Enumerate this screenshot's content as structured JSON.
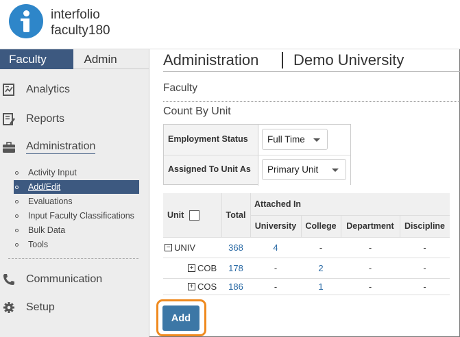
{
  "brand": {
    "line1": "interfolio",
    "line2": "faculty180"
  },
  "sidebar": {
    "tabs": [
      {
        "label": "Faculty"
      },
      {
        "label": "Admin"
      }
    ],
    "nav": {
      "analytics": "Analytics",
      "reports": "Reports",
      "administration": "Administration",
      "communication": "Communication",
      "setup": "Setup"
    },
    "subitems": [
      {
        "label": "Activity Input"
      },
      {
        "label": "Add/Edit"
      },
      {
        "label": "Evaluations"
      },
      {
        "label": "Input Faculty Classifications"
      },
      {
        "label": "Bulk Data"
      },
      {
        "label": "Tools"
      }
    ]
  },
  "main": {
    "title": "Administration",
    "university": "Demo University",
    "section": "Faculty",
    "subsection": "Count By Unit",
    "filters": {
      "employment_status": {
        "label": "Employment Status",
        "value": "Full Time"
      },
      "assigned_to_unit_as": {
        "label": "Assigned To Unit As",
        "value": "Primary Unit"
      }
    },
    "table": {
      "headers": {
        "unit": "Unit",
        "total": "Total",
        "attached_in": "Attached In",
        "university": "University",
        "college": "College",
        "department": "Department",
        "discipline": "Discipline"
      },
      "rows": [
        {
          "expander": "−",
          "unit": "UNIV",
          "total": "368",
          "university": "4",
          "college": "-",
          "department": "-",
          "discipline": "-"
        },
        {
          "expander": "+",
          "unit": "COB",
          "total": "178",
          "university": "-",
          "college": "2",
          "department": "-",
          "discipline": "-"
        },
        {
          "expander": "+",
          "unit": "COS",
          "total": "186",
          "university": "-",
          "college": "1",
          "department": "-",
          "discipline": "-"
        }
      ]
    },
    "add_label": "Add"
  },
  "colors": {
    "nav_active": "#3d5980",
    "link": "#2a6aa5",
    "button": "#3c77a6",
    "highlight": "#ef8a1f",
    "logo": "#2e86c9"
  }
}
